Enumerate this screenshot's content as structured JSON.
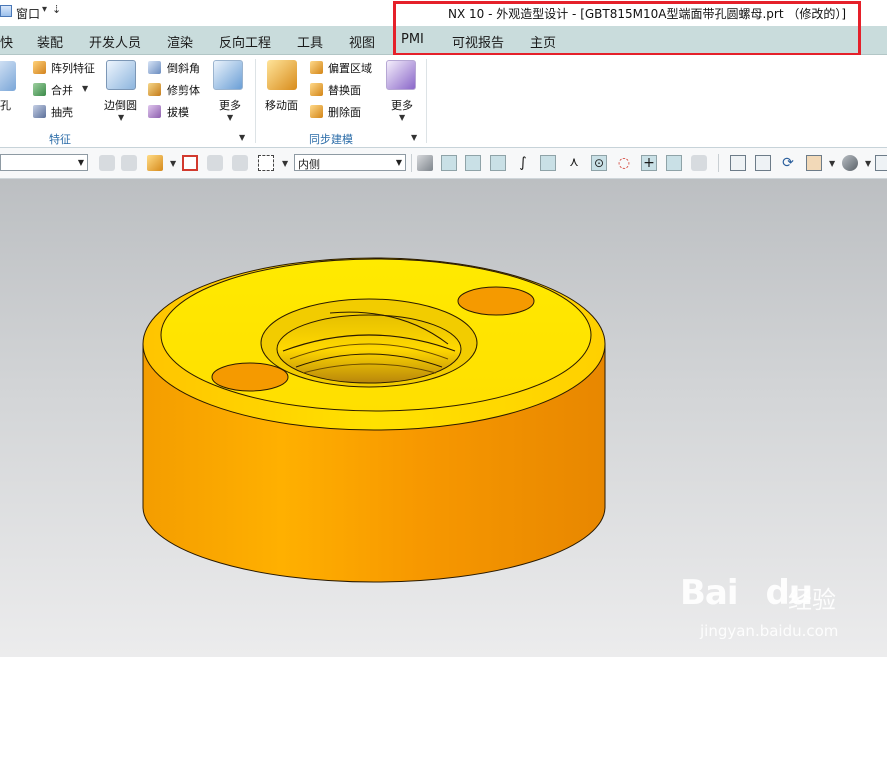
{
  "titlebar": {
    "window_menu": "窗口",
    "window_title": "NX 10 - 外观造型设计 - [GBT815M10A型端面带孔圆螺母.prt （修改的）]"
  },
  "tabs": [
    "快",
    "装配",
    "开发人员",
    "渲染",
    "反向工程",
    "工具",
    "视图",
    "PMI",
    "可视报告",
    "主页"
  ],
  "ribbon": {
    "feature_group": {
      "hole_label": "孔",
      "pattern_label": "阵列特征",
      "unite_label": "合并",
      "shell_label": "抽壳",
      "edge_blend_label": "边倒圆",
      "chamfer_label": "倒斜角",
      "trim_body_label": "修剪体",
      "draft_label": "拔模",
      "more_label": "更多",
      "group_label": "特征"
    },
    "sync_group": {
      "move_face_label": "移动面",
      "offset_region_label": "偏置区域",
      "replace_face_label": "替换面",
      "delete_face_label": "删除面",
      "more_label": "更多",
      "group_label": "同步建模"
    }
  },
  "toolbar": {
    "filter_value": "",
    "inside_select_value": "内侧"
  },
  "watermark": {
    "logo_text": "Bai",
    "logo_text_suffix": "du",
    "cn_text": "经验",
    "url": "jingyan.baidu.com"
  },
  "colors": {
    "highlight_box": "#e5202a",
    "tab_bar": "#c9dcdc",
    "model_top": "#ffec00",
    "model_side": "#f59a00"
  }
}
